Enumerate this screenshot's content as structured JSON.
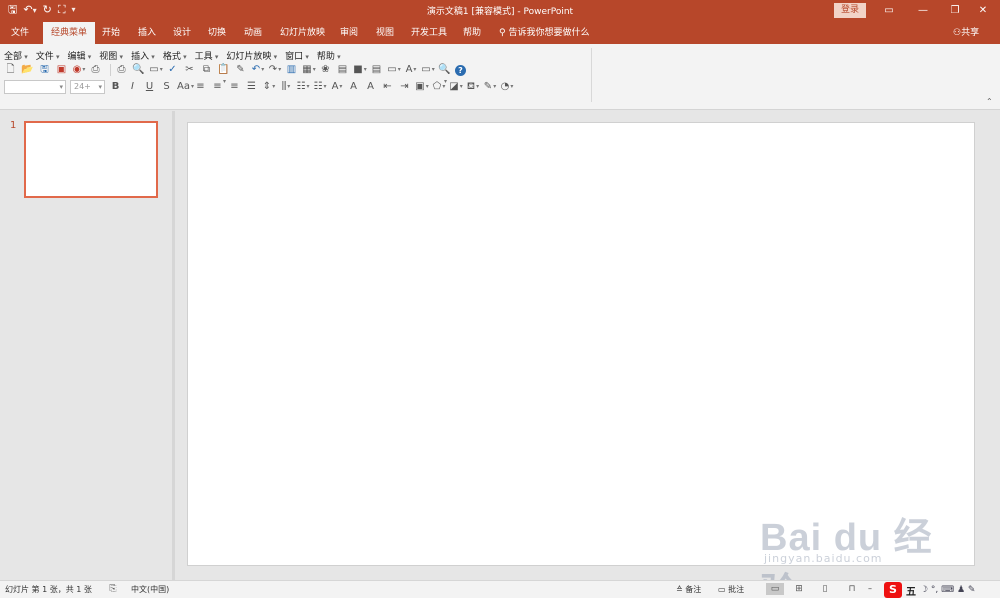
{
  "window": {
    "title": "演示文稿1 [兼容模式]  -  PowerPoint",
    "login_label": "登录",
    "controls": [
      "ribbon-display",
      "minimize",
      "restore",
      "close"
    ]
  },
  "quick_access": {
    "icons": [
      "save-icon",
      "undo-icon",
      "redo-icon",
      "start-from-beginning-icon",
      "customize-icon"
    ]
  },
  "tabs": [
    {
      "label": "文件",
      "active": false
    },
    {
      "label": "经典菜单",
      "active": true
    },
    {
      "label": "开始",
      "active": false
    },
    {
      "label": "插入",
      "active": false
    },
    {
      "label": "设计",
      "active": false
    },
    {
      "label": "切换",
      "active": false
    },
    {
      "label": "动画",
      "active": false
    },
    {
      "label": "幻灯片放映",
      "active": false
    },
    {
      "label": "审阅",
      "active": false
    },
    {
      "label": "视图",
      "active": false
    },
    {
      "label": "开发工具",
      "active": false
    },
    {
      "label": "帮助",
      "active": false
    }
  ],
  "tell_me": "告诉我你想要做什么",
  "share_label": "共享",
  "classic_menu": {
    "items": [
      "全部",
      "文件",
      "编辑",
      "视图",
      "插入",
      "格式",
      "工具",
      "幻灯片放映",
      "窗口",
      "帮助"
    ],
    "font_size_value": "24+"
  },
  "slides_pane": {
    "slide_number": "1"
  },
  "status_bar": {
    "slide_info": "幻灯片 第 1 张，共 1 张",
    "language": "中文(中国)",
    "notes_label": "备注",
    "comments_label": "批注",
    "zoom_minus": "–"
  },
  "ime": {
    "wu": "五"
  },
  "watermark": {
    "brand": "Bai du 经验",
    "site": "jingyan.baidu.com"
  },
  "colors": {
    "accent": "#b7472a",
    "thumb_border": "#e1694a"
  }
}
